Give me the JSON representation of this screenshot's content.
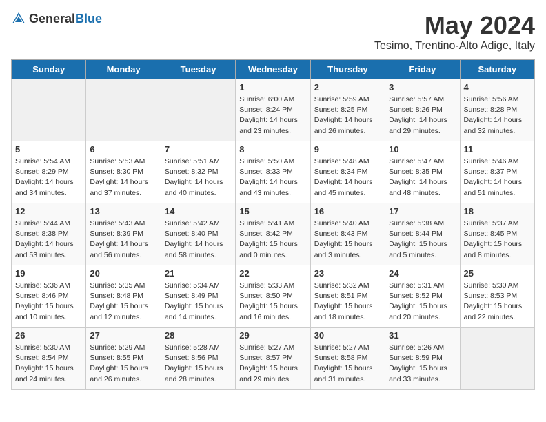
{
  "logo": {
    "general": "General",
    "blue": "Blue"
  },
  "title": "May 2024",
  "location": "Tesimo, Trentino-Alto Adige, Italy",
  "weekdays": [
    "Sunday",
    "Monday",
    "Tuesday",
    "Wednesday",
    "Thursday",
    "Friday",
    "Saturday"
  ],
  "weeks": [
    [
      {
        "day": "",
        "info": ""
      },
      {
        "day": "",
        "info": ""
      },
      {
        "day": "",
        "info": ""
      },
      {
        "day": "1",
        "info": "Sunrise: 6:00 AM\nSunset: 8:24 PM\nDaylight: 14 hours\nand 23 minutes."
      },
      {
        "day": "2",
        "info": "Sunrise: 5:59 AM\nSunset: 8:25 PM\nDaylight: 14 hours\nand 26 minutes."
      },
      {
        "day": "3",
        "info": "Sunrise: 5:57 AM\nSunset: 8:26 PM\nDaylight: 14 hours\nand 29 minutes."
      },
      {
        "day": "4",
        "info": "Sunrise: 5:56 AM\nSunset: 8:28 PM\nDaylight: 14 hours\nand 32 minutes."
      }
    ],
    [
      {
        "day": "5",
        "info": "Sunrise: 5:54 AM\nSunset: 8:29 PM\nDaylight: 14 hours\nand 34 minutes."
      },
      {
        "day": "6",
        "info": "Sunrise: 5:53 AM\nSunset: 8:30 PM\nDaylight: 14 hours\nand 37 minutes."
      },
      {
        "day": "7",
        "info": "Sunrise: 5:51 AM\nSunset: 8:32 PM\nDaylight: 14 hours\nand 40 minutes."
      },
      {
        "day": "8",
        "info": "Sunrise: 5:50 AM\nSunset: 8:33 PM\nDaylight: 14 hours\nand 43 minutes."
      },
      {
        "day": "9",
        "info": "Sunrise: 5:48 AM\nSunset: 8:34 PM\nDaylight: 14 hours\nand 45 minutes."
      },
      {
        "day": "10",
        "info": "Sunrise: 5:47 AM\nSunset: 8:35 PM\nDaylight: 14 hours\nand 48 minutes."
      },
      {
        "day": "11",
        "info": "Sunrise: 5:46 AM\nSunset: 8:37 PM\nDaylight: 14 hours\nand 51 minutes."
      }
    ],
    [
      {
        "day": "12",
        "info": "Sunrise: 5:44 AM\nSunset: 8:38 PM\nDaylight: 14 hours\nand 53 minutes."
      },
      {
        "day": "13",
        "info": "Sunrise: 5:43 AM\nSunset: 8:39 PM\nDaylight: 14 hours\nand 56 minutes."
      },
      {
        "day": "14",
        "info": "Sunrise: 5:42 AM\nSunset: 8:40 PM\nDaylight: 14 hours\nand 58 minutes."
      },
      {
        "day": "15",
        "info": "Sunrise: 5:41 AM\nSunset: 8:42 PM\nDaylight: 15 hours\nand 0 minutes."
      },
      {
        "day": "16",
        "info": "Sunrise: 5:40 AM\nSunset: 8:43 PM\nDaylight: 15 hours\nand 3 minutes."
      },
      {
        "day": "17",
        "info": "Sunrise: 5:38 AM\nSunset: 8:44 PM\nDaylight: 15 hours\nand 5 minutes."
      },
      {
        "day": "18",
        "info": "Sunrise: 5:37 AM\nSunset: 8:45 PM\nDaylight: 15 hours\nand 8 minutes."
      }
    ],
    [
      {
        "day": "19",
        "info": "Sunrise: 5:36 AM\nSunset: 8:46 PM\nDaylight: 15 hours\nand 10 minutes."
      },
      {
        "day": "20",
        "info": "Sunrise: 5:35 AM\nSunset: 8:48 PM\nDaylight: 15 hours\nand 12 minutes."
      },
      {
        "day": "21",
        "info": "Sunrise: 5:34 AM\nSunset: 8:49 PM\nDaylight: 15 hours\nand 14 minutes."
      },
      {
        "day": "22",
        "info": "Sunrise: 5:33 AM\nSunset: 8:50 PM\nDaylight: 15 hours\nand 16 minutes."
      },
      {
        "day": "23",
        "info": "Sunrise: 5:32 AM\nSunset: 8:51 PM\nDaylight: 15 hours\nand 18 minutes."
      },
      {
        "day": "24",
        "info": "Sunrise: 5:31 AM\nSunset: 8:52 PM\nDaylight: 15 hours\nand 20 minutes."
      },
      {
        "day": "25",
        "info": "Sunrise: 5:30 AM\nSunset: 8:53 PM\nDaylight: 15 hours\nand 22 minutes."
      }
    ],
    [
      {
        "day": "26",
        "info": "Sunrise: 5:30 AM\nSunset: 8:54 PM\nDaylight: 15 hours\nand 24 minutes."
      },
      {
        "day": "27",
        "info": "Sunrise: 5:29 AM\nSunset: 8:55 PM\nDaylight: 15 hours\nand 26 minutes."
      },
      {
        "day": "28",
        "info": "Sunrise: 5:28 AM\nSunset: 8:56 PM\nDaylight: 15 hours\nand 28 minutes."
      },
      {
        "day": "29",
        "info": "Sunrise: 5:27 AM\nSunset: 8:57 PM\nDaylight: 15 hours\nand 29 minutes."
      },
      {
        "day": "30",
        "info": "Sunrise: 5:27 AM\nSunset: 8:58 PM\nDaylight: 15 hours\nand 31 minutes."
      },
      {
        "day": "31",
        "info": "Sunrise: 5:26 AM\nSunset: 8:59 PM\nDaylight: 15 hours\nand 33 minutes."
      },
      {
        "day": "",
        "info": ""
      }
    ]
  ]
}
